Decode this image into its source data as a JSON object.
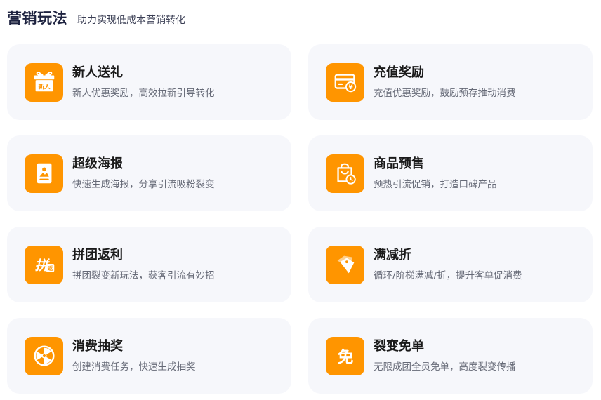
{
  "header": {
    "title": "营销玩法",
    "subtitle": "助力实现低成本营销转化"
  },
  "cards": [
    {
      "title": "新人送礼",
      "desc": "新人优惠奖励，高效拉新引导转化",
      "icon": "gift-icon",
      "icon_text": "新人"
    },
    {
      "title": "充值奖励",
      "desc": "充值优惠奖励，鼓励预存推动消费",
      "icon": "recharge-card-icon",
      "icon_text": "¥"
    },
    {
      "title": "超级海报",
      "desc": "快速生成海报，分享引流吸粉裂变",
      "icon": "poster-icon"
    },
    {
      "title": "商品预售",
      "desc": "预热引流促销，打造口碑产品",
      "icon": "presale-bag-clock-icon"
    },
    {
      "title": "拼团返利",
      "desc": "拼团裂变新玩法，获客引流有妙招",
      "icon": "group-buy-icon",
      "icon_text": "拼",
      "icon_badge": "返"
    },
    {
      "title": "满减折",
      "desc": "循环/阶梯满减/折，提升客单促消费",
      "icon": "discount-tag-icon"
    },
    {
      "title": "消费抽奖",
      "desc": "创建消费任务，快速生成抽奖",
      "icon": "lottery-wheel-icon"
    },
    {
      "title": "裂变免单",
      "desc": "无限成团全员免单，高度裂变传播",
      "icon": "free-order-icon",
      "icon_text": "免"
    }
  ],
  "colors": {
    "accent": "#ff9500",
    "card_bg": "#f6f7fb",
    "title": "#1e2340"
  }
}
